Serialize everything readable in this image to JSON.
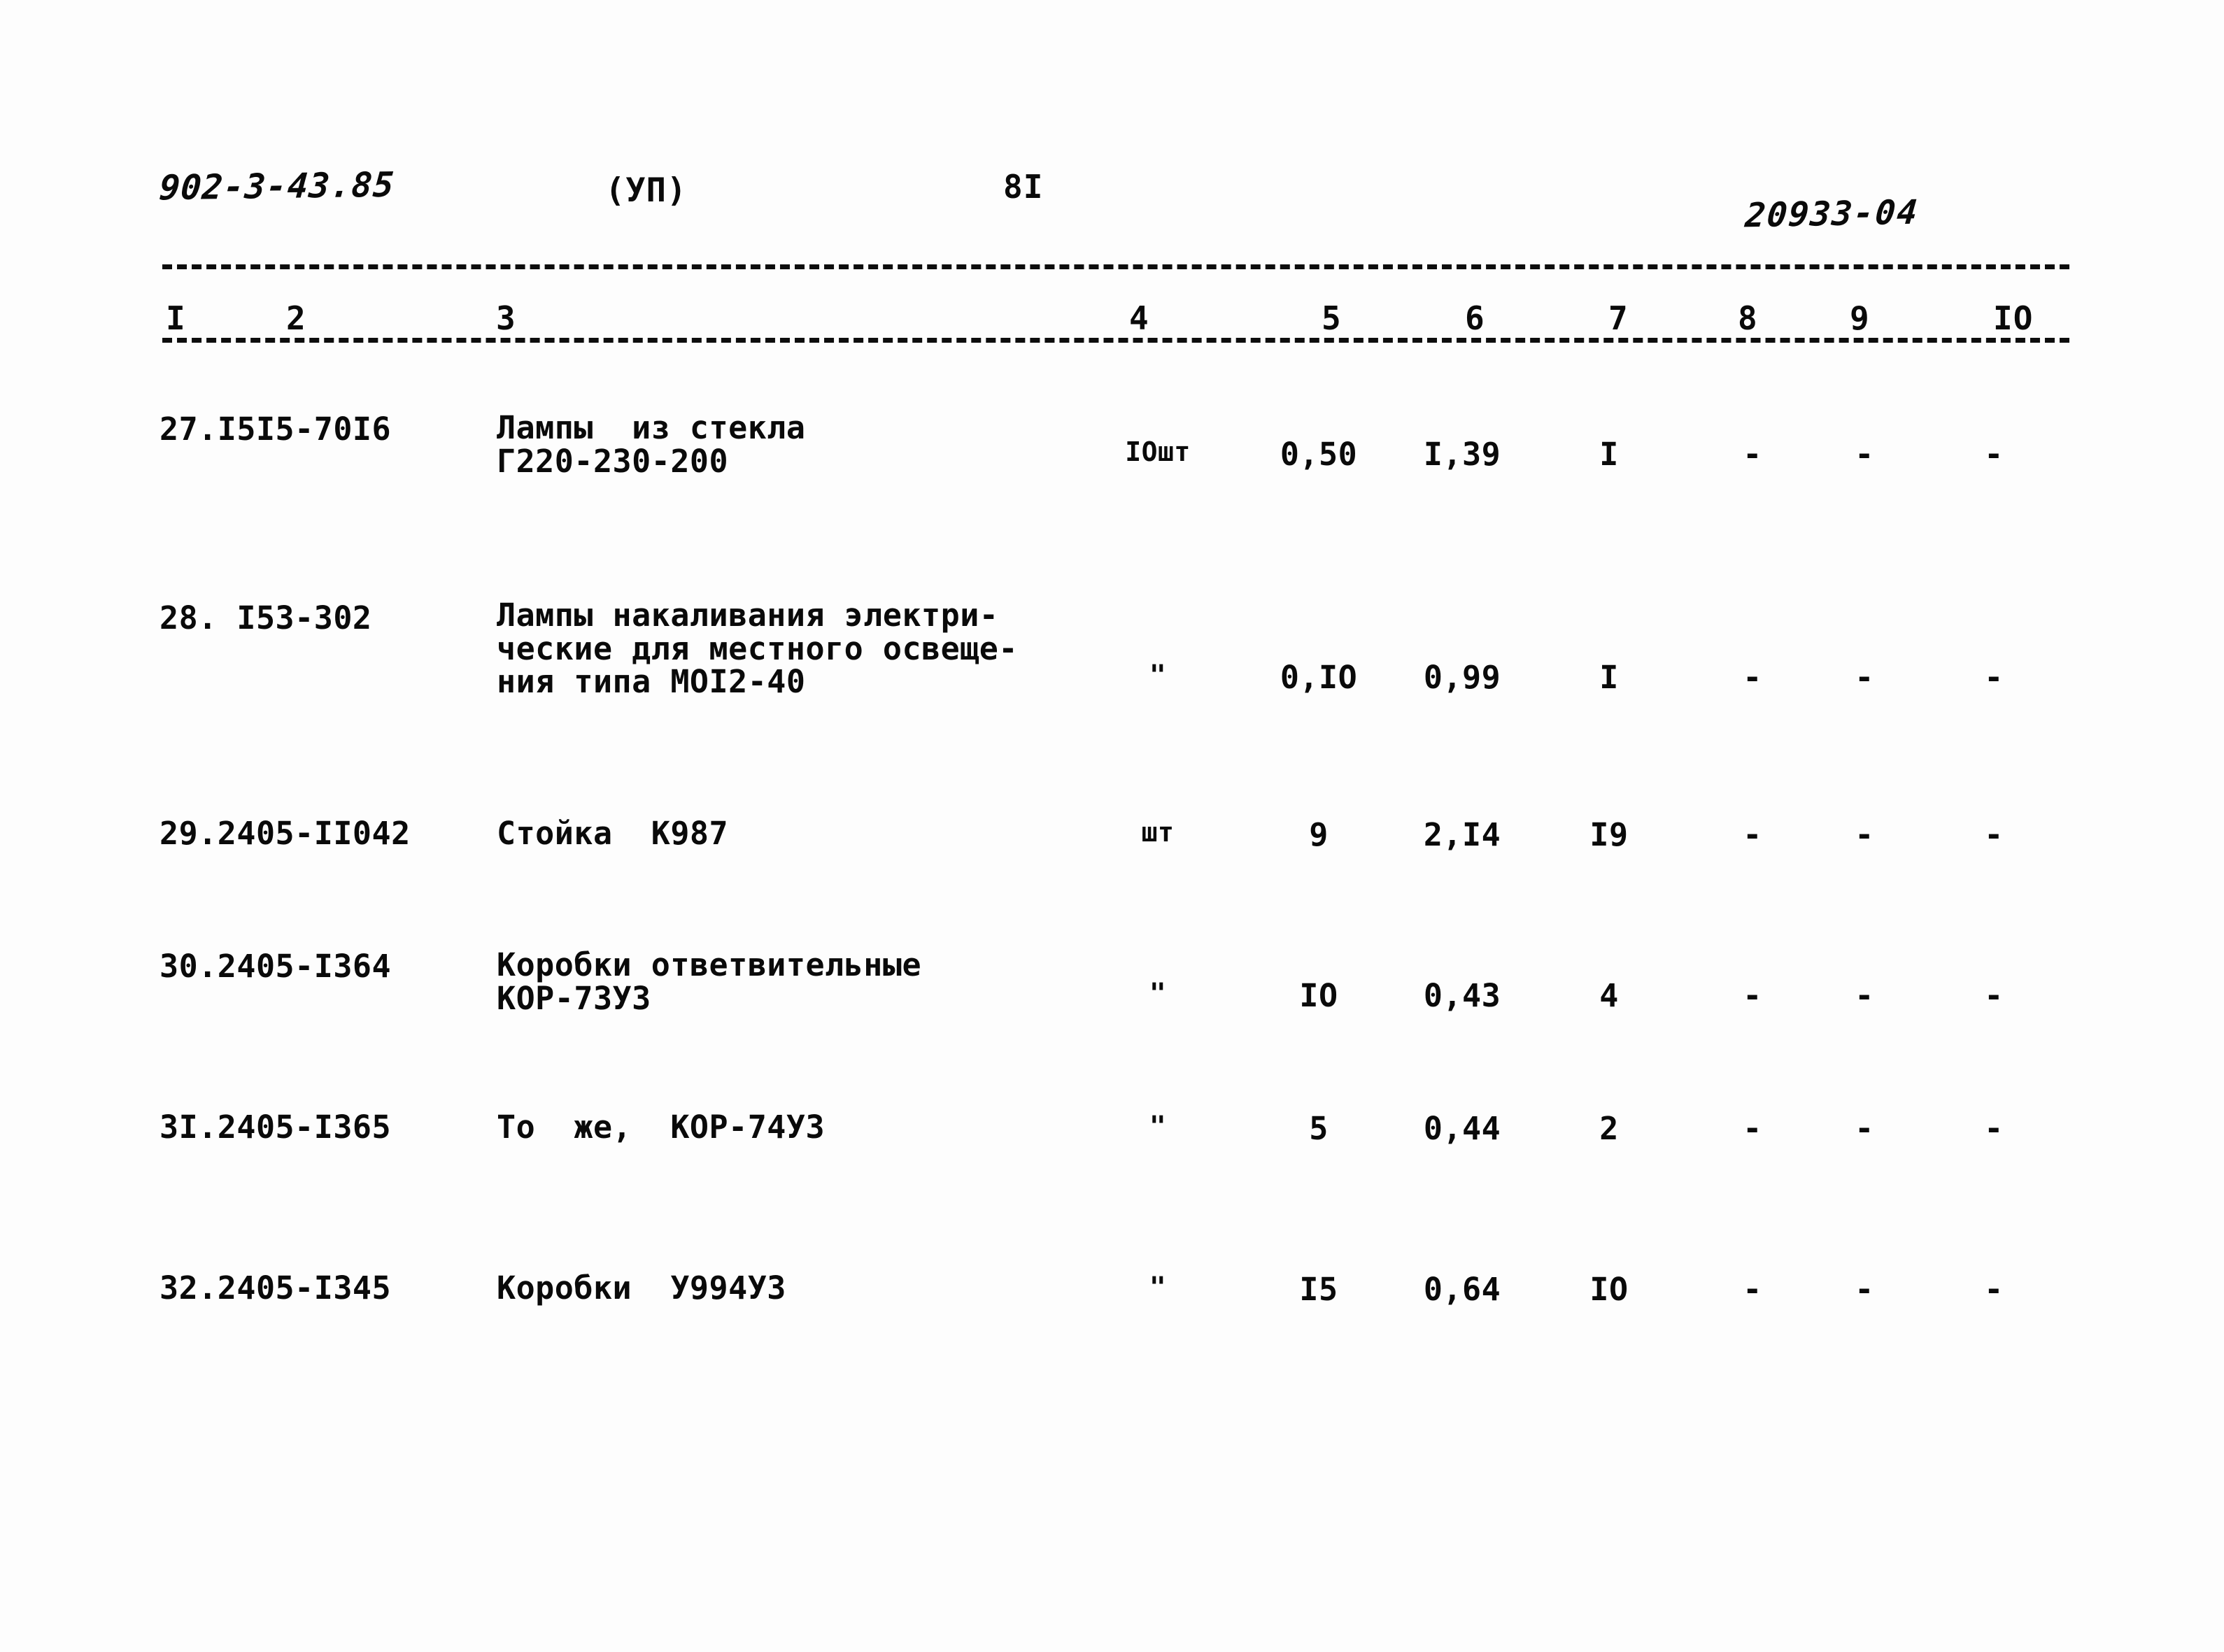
{
  "header": {
    "doc_code": "902-3-43.85",
    "section": "(УП)",
    "page_number": "8I",
    "sheet_code": "20933-04"
  },
  "table": {
    "column_numbers": [
      "I",
      "2",
      "3",
      "4",
      "5",
      "6",
      "7",
      "8",
      "9",
      "IO"
    ],
    "rows": [
      {
        "no": "27.I5I5-70I6",
        "name": "Лампы  из стекла\nГ220-230-200",
        "unit": "IOшт",
        "c5": "0,50",
        "c6": "I,39",
        "c7": "I",
        "c8": "-",
        "c9": "-",
        "c10": "-"
      },
      {
        "no": "28. I53-302",
        "name": "Лампы накаливания электри-\nческие для местного освеще-\nния типа МОI2-40",
        "unit": "\"",
        "c5": "0,IO",
        "c6": "0,99",
        "c7": "I",
        "c8": "-",
        "c9": "-",
        "c10": "-"
      },
      {
        "no": "29.2405-II042",
        "name": "Стойка  К987",
        "unit": "шт",
        "c5": "9",
        "c6": "2,I4",
        "c7": "I9",
        "c8": "-",
        "c9": "-",
        "c10": "-"
      },
      {
        "no": "30.2405-I364",
        "name": "Коробки ответвительные\nКОР-73УЗ",
        "unit": "\"",
        "c5": "IO",
        "c6": "0,43",
        "c7": "4",
        "c8": "-",
        "c9": "-",
        "c10": "-"
      },
      {
        "no": "3I.2405-I365",
        "name": "То  же,  КОР-74УЗ",
        "unit": "\"",
        "c5": "5",
        "c6": "0,44",
        "c7": "2",
        "c8": "-",
        "c9": "-",
        "c10": "-"
      },
      {
        "no": "32.2405-I345",
        "name": "Коробки  У994УЗ",
        "unit": "\"",
        "c5": "I5",
        "c6": "0,64",
        "c7": "IO",
        "c8": "-",
        "c9": "-",
        "c10": "-"
      }
    ]
  }
}
